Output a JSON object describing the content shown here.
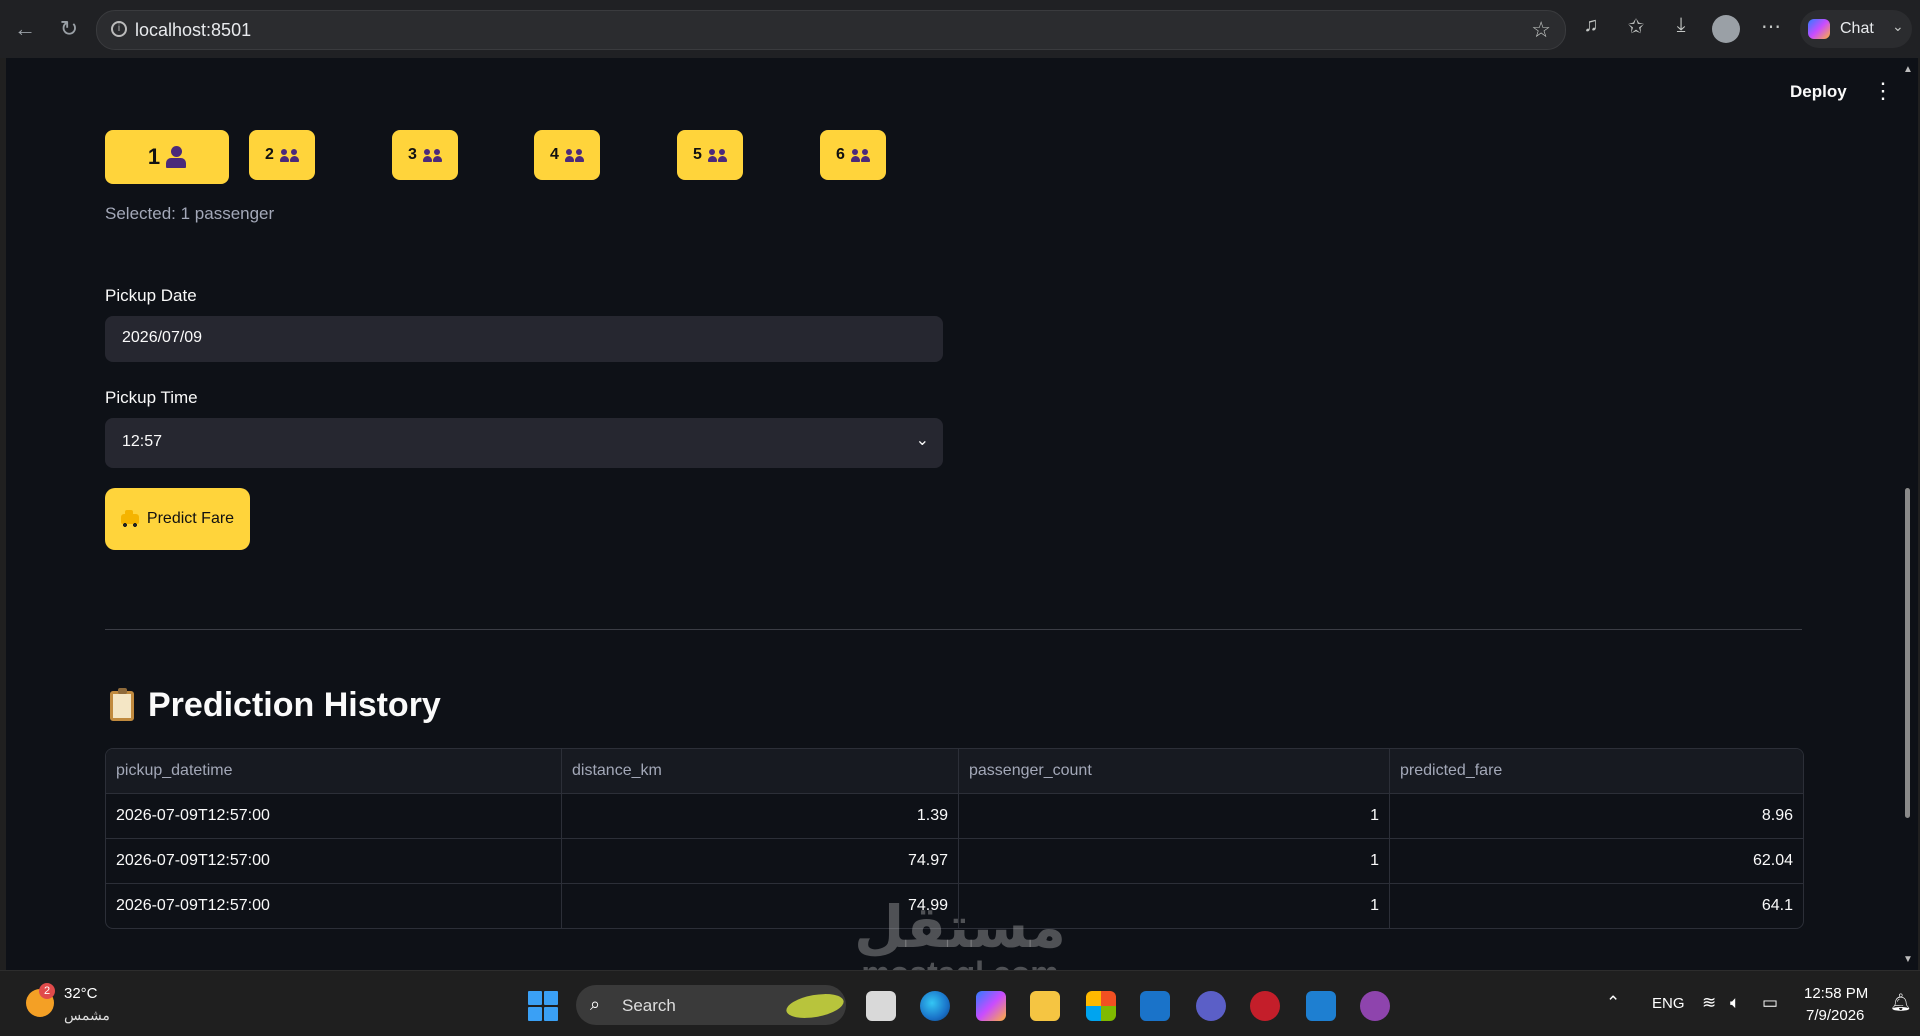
{
  "browser": {
    "url": "localhost:8501",
    "chat_label": "Chat"
  },
  "app": {
    "deploy_label": "Deploy",
    "menu_glyph": "⋮",
    "passenger_buttons": [
      {
        "label": "1",
        "icon": "person-icon"
      },
      {
        "label": "2",
        "icon": "people-icon"
      },
      {
        "label": "3",
        "icon": "people-icon"
      },
      {
        "label": "4",
        "icon": "people-icon"
      },
      {
        "label": "5",
        "icon": "people-icon"
      },
      {
        "label": "6",
        "icon": "people-icon"
      }
    ],
    "selected_text": "Selected: 1 passenger",
    "pickup_date": {
      "label": "Pickup Date",
      "value": "2026/07/09"
    },
    "pickup_time": {
      "label": "Pickup Time",
      "value": "12:57"
    },
    "predict_label": "Predict Fare",
    "history_title": "Prediction History",
    "table": {
      "columns": [
        "pickup_datetime",
        "distance_km",
        "passenger_count",
        "predicted_fare"
      ],
      "rows": [
        [
          "2026-07-09T12:57:00",
          "1.39",
          "1",
          "8.96"
        ],
        [
          "2026-07-09T12:57:00",
          "74.97",
          "1",
          "62.04"
        ],
        [
          "2026-07-09T12:57:00",
          "74.99",
          "1",
          "64.1"
        ]
      ]
    },
    "accent_color": "#ffd43b",
    "background_color": "#0e1117"
  },
  "watermark": {
    "arabic": "مستقل",
    "latin": "mostaql.com"
  },
  "taskbar": {
    "weather_badge": "2",
    "temperature": "32°C",
    "weather_desc": "مشمس",
    "search_label": "Search",
    "language": "ENG",
    "time": "12:58 PM",
    "date": "7/9/2026"
  }
}
